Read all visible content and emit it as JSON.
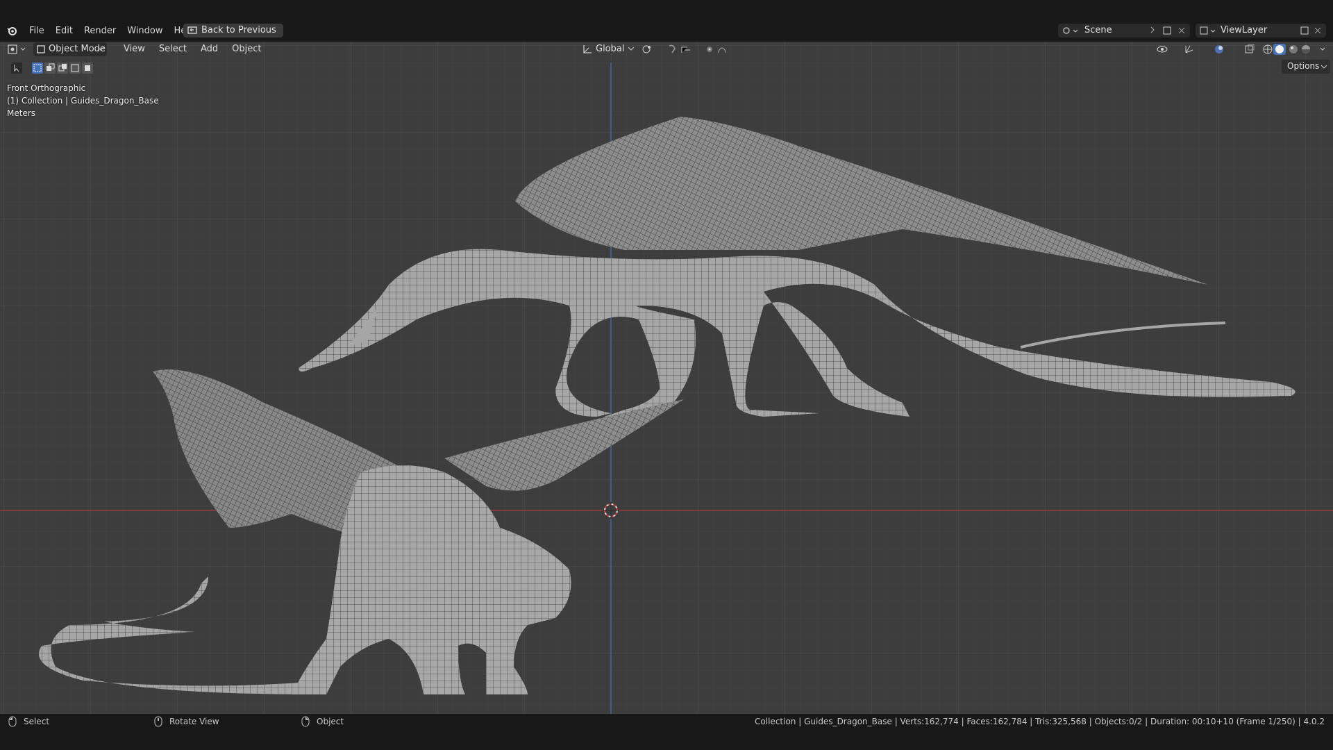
{
  "menubar": {
    "items": [
      "File",
      "Edit",
      "Render",
      "Window",
      "Help"
    ],
    "back_button": "Back to Previous",
    "scene": "Scene",
    "view_layer": "ViewLayer"
  },
  "viewport_header": {
    "mode": "Object Mode",
    "menus": [
      "View",
      "Select",
      "Add",
      "Object"
    ],
    "transform_orientation": "Global",
    "options": "Options"
  },
  "overlay": {
    "view_name": "Front Orthographic",
    "collection": "(1) Collection | Guides_Dragon_Base",
    "units": "Meters"
  },
  "statusbar": {
    "select": "Select",
    "rotate": "Rotate View",
    "object": "Object",
    "stats": "Collection | Guides_Dragon_Base | Verts:162,774 | Faces:162,784 | Tris:325,568 | Objects:0/2 | Duration: 00:10+10 (Frame 1/250) | 4.0.2"
  },
  "colors": {
    "viewport_bg": "#3d3d3d",
    "x_axis": "#b0383f",
    "z_axis": "#3b6fb5",
    "mesh": "#9a9a9a"
  }
}
